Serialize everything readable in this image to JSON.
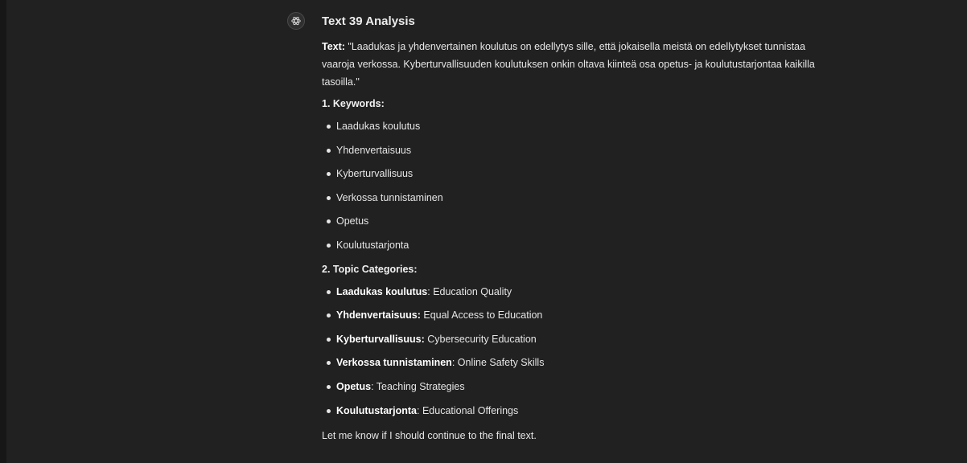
{
  "message": {
    "avatar_icon": "openai-logo-icon",
    "title": "Text 39 Analysis",
    "text_label": "Text:",
    "text_body": "\"Laadukas ja yhdenvertainen koulutus on edellytys sille, että jokaisella meistä on edellytykset tunnistaa vaaroja verkossa. Kyberturvallisuuden koulutuksen onkin oltava kiinteä osa opetus- ja koulutustarjontaa kaikilla tasoilla.\"",
    "keywords_heading": "1. Keywords:",
    "keywords": [
      "Laadukas koulutus",
      "Yhdenvertaisuus",
      "Kyberturvallisuus",
      "Verkossa tunnistaminen",
      "Opetus",
      "Koulutustarjonta"
    ],
    "categories_heading": "2. Topic Categories:",
    "categories": [
      {
        "term": "Laadukas koulutus",
        "sep": ":",
        "desc": " Education Quality"
      },
      {
        "term": "Yhdenvertaisuus:",
        "sep": "",
        "desc": " Equal Access to Education"
      },
      {
        "term": "Kyberturvallisuus:",
        "sep": "",
        "desc": " Cybersecurity Education"
      },
      {
        "term": "Verkossa tunnistaminen",
        "sep": ":",
        "desc": " Online Safety Skills"
      },
      {
        "term": "Opetus",
        "sep": ":",
        "desc": " Teaching Strategies"
      },
      {
        "term": "Koulutustarjonta",
        "sep": ":",
        "desc": " Educational Offerings"
      }
    ],
    "closing": "Let me know if I should continue to the final text."
  }
}
